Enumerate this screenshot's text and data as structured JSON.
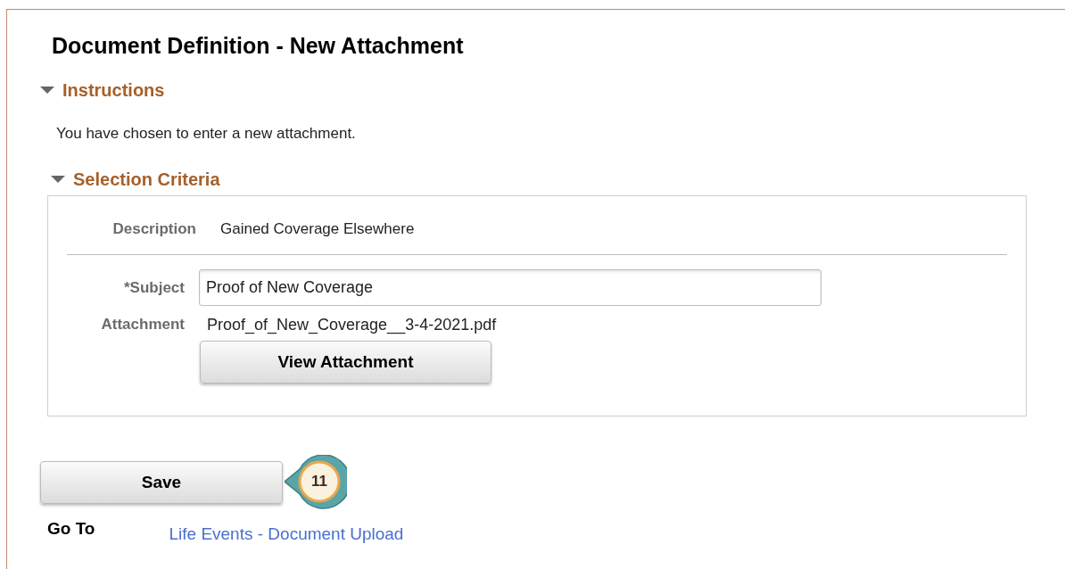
{
  "page_title": "Document Definition - New Attachment",
  "sections": [
    {
      "title": "Instructions",
      "expanded": true,
      "kind": "text",
      "text": "You have chosen to enter a new attachment."
    },
    {
      "title": "Selection Criteria",
      "expanded": true,
      "kind": "form",
      "description": {
        "label": "Description",
        "value": "Gained Coverage Elsewhere"
      },
      "subject": {
        "label": "*Subject",
        "value": "Proof of New Coverage"
      },
      "attachment": {
        "label": "Attachment",
        "file_name": "Proof_of_New_Coverage__3-4-2021.pdf",
        "button": "View Attachment"
      }
    }
  ],
  "save_button": "Save",
  "step_callout": "11",
  "go_to": {
    "label": "Go To",
    "link": "Life Events - Document Upload"
  }
}
